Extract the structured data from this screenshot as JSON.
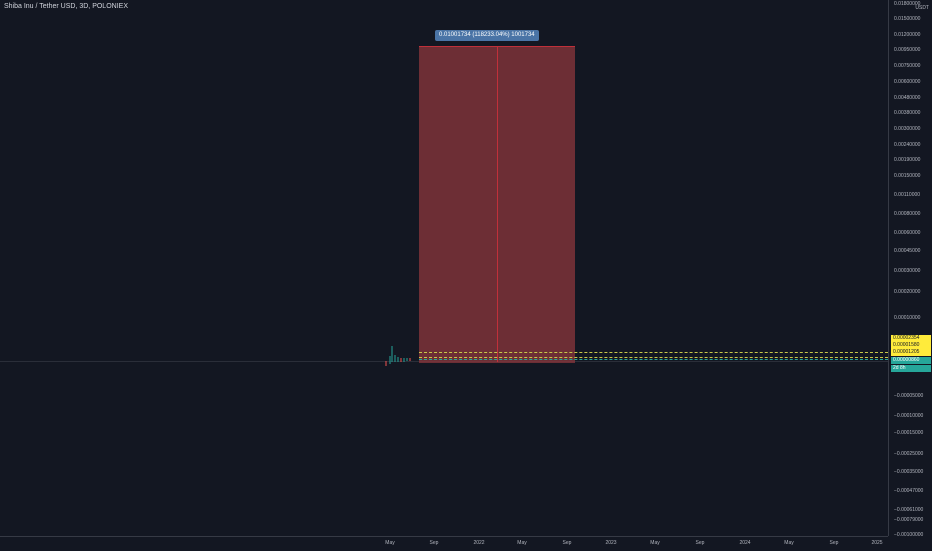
{
  "title": "Shiba Inu / Tether USD, 3D, POLONIEX",
  "currency": "USDT",
  "measure_label": "0.01001734 (118233.04%) 1001734",
  "colors": {
    "background": "#131722",
    "range_fill": "#8c373c",
    "range_label": "#4a74a6",
    "tag_yellow": "#ffeb3b",
    "tag_teal": "#26a69a"
  },
  "price_axis": {
    "top_cut_tick": "0.01800000",
    "ticks": [
      "0.01500000",
      "0.01200000",
      "0.00950000",
      "0.00750000",
      "0.00600000",
      "0.00480000",
      "0.00380000",
      "0.00300000",
      "0.00240000",
      "0.00190000",
      "0.00150000",
      "0.00110000",
      "0.00080000",
      "0.00060000",
      "0.00045000",
      "0.00030000",
      "0.00020000",
      "0.00010000",
      "−0.00005000",
      "−0.00010000",
      "−0.00015000",
      "−0.00025000",
      "−0.00035000",
      "−0.00047000",
      "−0.00061000",
      "−0.00079000",
      "−0.00100000"
    ],
    "price_tags": [
      "0.00002354",
      "0.00001580",
      "0.00001205",
      "0.00000860"
    ],
    "countdown": "2d 8h"
  },
  "time_axis": {
    "ticks": [
      "May",
      "Sep",
      "2022",
      "May",
      "Sep",
      "2023",
      "May",
      "Sep",
      "2024",
      "May",
      "Sep",
      "2025"
    ]
  },
  "chart_data": {
    "type": "line",
    "title": "Shiba Inu / Tether USD, 3D, POLONIEX",
    "x_range": [
      "2021-05",
      "2025-01"
    ],
    "y_scale": "custom",
    "series": [
      {
        "values": [
          8.6e-06,
          2.354e-05,
          1.58e-05,
          1.205e-05,
          8.6e-06
        ]
      }
    ],
    "measure_box": {
      "x_start": "2021-08",
      "x_end": "2022-09",
      "y_from": 8.6e-06,
      "y_to": 0.01001734,
      "change_percent": 118233.04,
      "label": "0.01001734 (118233.04%) 1001734"
    },
    "grid": false
  }
}
